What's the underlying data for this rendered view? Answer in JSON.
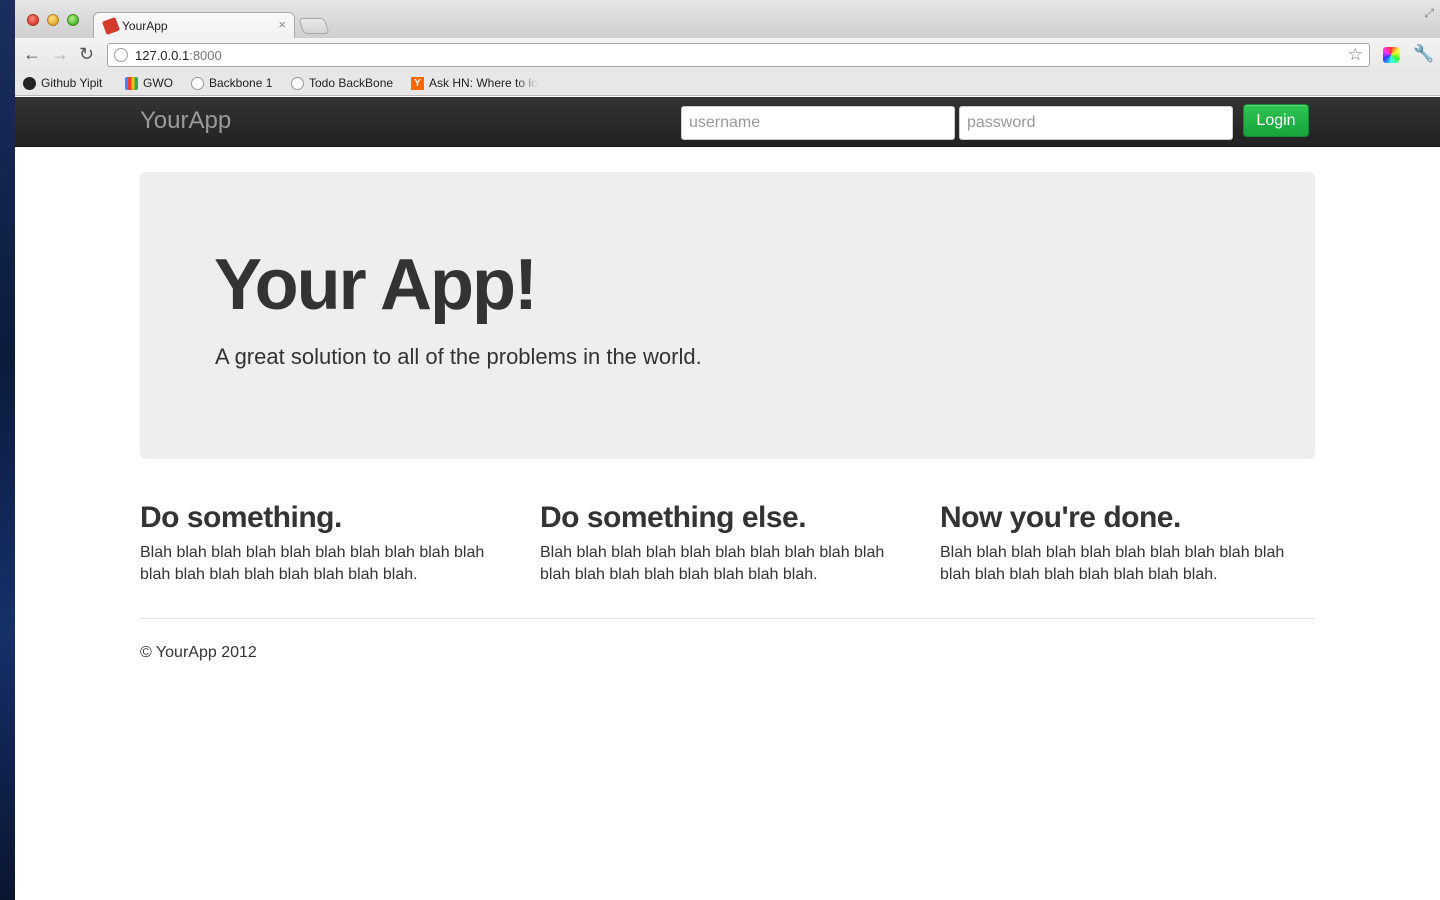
{
  "browser": {
    "tab_title": "YourApp",
    "tab_close": "×",
    "url_host": "127.0.0.1",
    "url_port": ":8000",
    "bookmarks": [
      {
        "label": "Github Yipit",
        "icon": "github-icon"
      },
      {
        "label": "GWO",
        "icon": "google-icon"
      },
      {
        "label": "Backbone 1",
        "icon": "globe-icon"
      },
      {
        "label": "Todo BackBone",
        "icon": "globe-icon"
      },
      {
        "label": "Ask HN: Where to lo",
        "icon": "ycombinator-icon"
      }
    ]
  },
  "navbar": {
    "brand": "YourApp",
    "username_placeholder": "username",
    "password_placeholder": "password",
    "login_label": "Login"
  },
  "hero": {
    "title": "Your App!",
    "subtitle": "A great solution to all of the problems in the world."
  },
  "features": [
    {
      "heading": "Do something.",
      "text": "Blah blah blah blah blah blah blah blah blah blah blah blah blah blah blah blah blah blah."
    },
    {
      "heading": "Do something else.",
      "text": "Blah blah blah blah blah blah blah blah blah blah blah blah blah blah blah blah blah blah."
    },
    {
      "heading": "Now you're done.",
      "text": "Blah blah blah blah blah blah blah blah blah blah blah blah blah blah blah blah blah blah."
    }
  ],
  "footer": {
    "copyright": "© YourApp 2012"
  },
  "colors": {
    "navbar_bg": "#222222",
    "hero_bg": "#eeeeee",
    "login_button": "#16a33b",
    "text": "#333333"
  }
}
